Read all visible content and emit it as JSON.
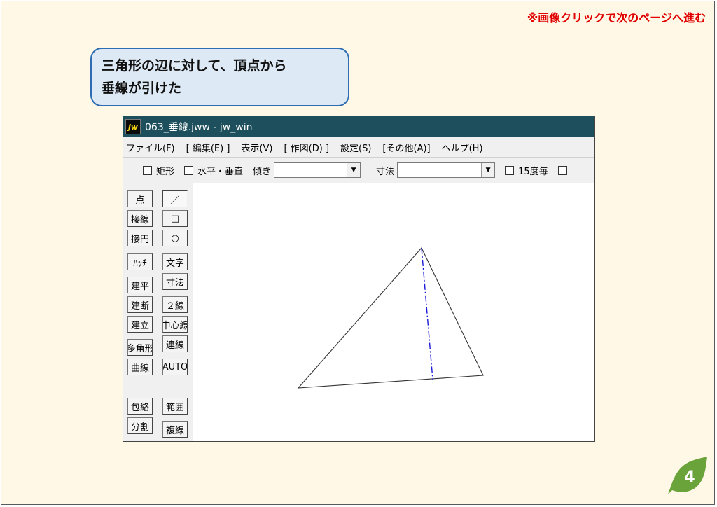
{
  "header": {
    "next_hint": "※画像クリックで次のページへ進む"
  },
  "callout": {
    "line1": "三角形の辺に対して、頂点から",
    "line2": "垂線が引けた"
  },
  "window": {
    "icon_text": "jw",
    "title": "063_垂線.jww - jw_win",
    "menu": [
      "ファイル(F)",
      "[ 編集(E) ]",
      "表示(V)",
      "[ 作図(D) ]",
      "設定(S)",
      "[その他(A)]",
      "ヘルプ(H)"
    ],
    "toolbar": {
      "rect_label": "矩形",
      "hv_label": "水平・垂直",
      "slope_label": "傾き",
      "slope_value": "",
      "dim_label": "寸法",
      "dim_value": "",
      "deg15_label": "15度毎"
    },
    "tools_left": [
      "点",
      "接線",
      "接円",
      "ﾊｯﾁ",
      "建平",
      "建断",
      "建立",
      "多角形",
      "曲線",
      "包絡",
      "分割"
    ],
    "tools_right": [
      "／",
      "□",
      "○",
      "文字",
      "寸法",
      "２線",
      "中心線",
      "連線",
      "AUTO",
      "範囲",
      "複線"
    ]
  },
  "drawing": {
    "line_color": "#333333",
    "perpendicular_color": "#1a1ad6"
  },
  "page_number": "4",
  "colors": {
    "accent": "#e00000",
    "callout_border": "#2e6db4",
    "badge": "#6aa33a",
    "titlebar": "#1e4f5c"
  }
}
